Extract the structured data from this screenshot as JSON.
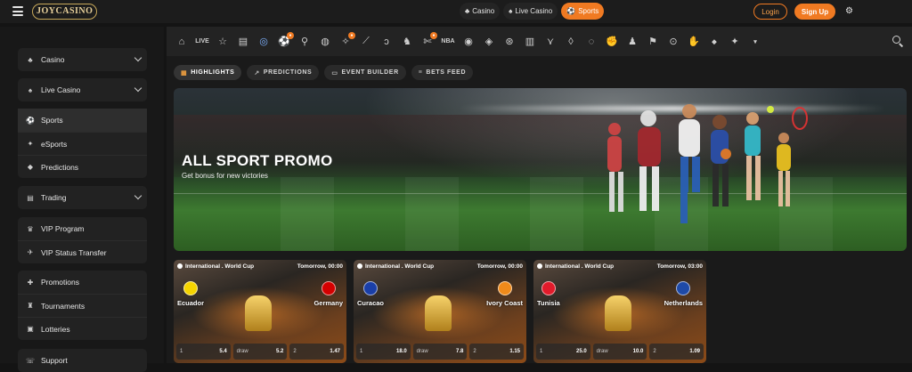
{
  "header": {
    "logo": "JOYCASINO",
    "modes": [
      {
        "label": "Casino",
        "icon": "casino-icon",
        "active": false
      },
      {
        "label": "Live Casino",
        "icon": "live-casino-icon",
        "active": false
      },
      {
        "label": "Sports",
        "icon": "sports-icon",
        "active": true
      }
    ],
    "login_label": "Login",
    "signup_label": "Sign Up"
  },
  "sidebar": {
    "groups": [
      {
        "items": [
          {
            "label": "Casino",
            "icon": "casino-icon",
            "expandable": true
          }
        ]
      },
      {
        "items": [
          {
            "label": "Live Casino",
            "icon": "live-casino-icon",
            "expandable": true
          }
        ]
      },
      {
        "items": [
          {
            "label": "Sports",
            "icon": "soccer-ball-icon",
            "active": true
          },
          {
            "label": "eSports",
            "icon": "esports-icon"
          },
          {
            "label": "Predictions",
            "icon": "predictions-icon"
          }
        ]
      },
      {
        "items": [
          {
            "label": "Trading",
            "icon": "trading-icon",
            "expandable": true
          }
        ]
      },
      {
        "items": [
          {
            "label": "VIP Program",
            "icon": "crown-icon"
          },
          {
            "label": "VIP Status Transfer",
            "icon": "plane-icon"
          }
        ]
      },
      {
        "items": [
          {
            "label": "Promotions",
            "icon": "gift-icon"
          },
          {
            "label": "Tournaments",
            "icon": "trophy-icon"
          },
          {
            "label": "Lotteries",
            "icon": "ticket-icon"
          }
        ]
      },
      {
        "items": [
          {
            "label": "Support",
            "icon": "support-icon"
          }
        ]
      }
    ]
  },
  "sport_bar": {
    "live_label": "LIVE",
    "nba_label": "NBA"
  },
  "tabs": [
    {
      "label": "HIGHLIGHTS",
      "icon": "highlights-icon",
      "active": true
    },
    {
      "label": "PREDICTIONS",
      "icon": "predictions-icon",
      "active": false
    },
    {
      "label": "EVENT BUILDER",
      "icon": "event-builder-icon",
      "active": false
    },
    {
      "label": "BETS FEED",
      "icon": "bets-feed-icon",
      "active": false
    }
  ],
  "banner": {
    "title": "ALL SPORT PROMO",
    "subtitle": "Get bonus for new victories"
  },
  "matches": [
    {
      "league": "International . World Cup",
      "time": "Tomorrow, 00:00",
      "home": "Ecuador",
      "away": "Germany",
      "home_flag": "#f5d400",
      "away_flag": "#d40000",
      "odds": [
        {
          "label": "1",
          "value": "5.4"
        },
        {
          "label": "draw",
          "value": "5.2"
        },
        {
          "label": "2",
          "value": "1.47"
        }
      ]
    },
    {
      "league": "International . World Cup",
      "time": "Tomorrow, 00:00",
      "home": "Curacao",
      "away": "Ivory Coast",
      "home_flag": "#1a3fa8",
      "away_flag": "#f08a1a",
      "odds": [
        {
          "label": "1",
          "value": "18.0"
        },
        {
          "label": "draw",
          "value": "7.8"
        },
        {
          "label": "2",
          "value": "1.15"
        }
      ]
    },
    {
      "league": "International . World Cup",
      "time": "Tomorrow, 03:00",
      "home": "Tunisia",
      "away": "Netherlands",
      "home_flag": "#e21b2b",
      "away_flag": "#1e4aa8",
      "odds": [
        {
          "label": "1",
          "value": "25.0"
        },
        {
          "label": "draw",
          "value": "10.0"
        },
        {
          "label": "2",
          "value": "1.09"
        }
      ]
    }
  ],
  "colors": {
    "accent": "#f07a22",
    "bg": "#141414",
    "panel": "#222222"
  }
}
